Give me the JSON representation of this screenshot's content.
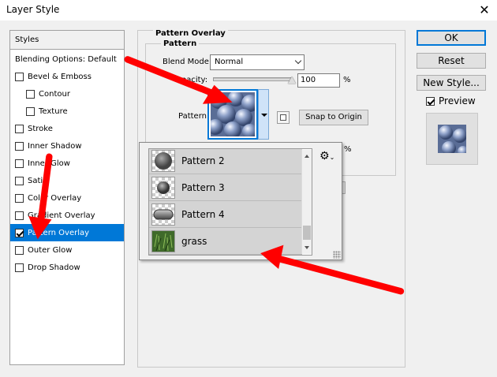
{
  "window": {
    "title": "Layer Style"
  },
  "sidebar": {
    "header": "Styles",
    "items": [
      {
        "label": "Blending Options: Default",
        "checkbox": false,
        "checked": false,
        "indent": 0
      },
      {
        "label": "Bevel & Emboss",
        "checkbox": true,
        "checked": false,
        "indent": 0
      },
      {
        "label": "Contour",
        "checkbox": true,
        "checked": false,
        "indent": 1
      },
      {
        "label": "Texture",
        "checkbox": true,
        "checked": false,
        "indent": 1
      },
      {
        "label": "Stroke",
        "checkbox": true,
        "checked": false,
        "indent": 0
      },
      {
        "label": "Inner Shadow",
        "checkbox": true,
        "checked": false,
        "indent": 0
      },
      {
        "label": "Inner Glow",
        "checkbox": true,
        "checked": false,
        "indent": 0
      },
      {
        "label": "Satin",
        "checkbox": true,
        "checked": false,
        "indent": 0
      },
      {
        "label": "Color Overlay",
        "checkbox": true,
        "checked": false,
        "indent": 0
      },
      {
        "label": "Gradient Overlay",
        "checkbox": true,
        "checked": false,
        "indent": 0
      },
      {
        "label": "Pattern Overlay",
        "checkbox": true,
        "checked": true,
        "indent": 0,
        "selected": true
      },
      {
        "label": "Outer Glow",
        "checkbox": true,
        "checked": false,
        "indent": 0
      },
      {
        "label": "Drop Shadow",
        "checkbox": true,
        "checked": false,
        "indent": 0
      }
    ]
  },
  "main": {
    "section_title": "Pattern Overlay",
    "group_title": "Pattern",
    "blend_mode_label": "Blend Mode:",
    "blend_mode_value": "Normal",
    "opacity_label": "Opacity:",
    "opacity_value": "100",
    "opacity_unit": "%",
    "opacity_level": 100,
    "pattern_label": "Pattern:",
    "snap_button": "Snap to Origin",
    "scale_unit": "%"
  },
  "pattern_picker": {
    "items": [
      {
        "name": "Pattern 2",
        "thumb": "sphere-pattern"
      },
      {
        "name": "Pattern 3",
        "thumb": "dot-pattern"
      },
      {
        "name": "Pattern 4",
        "thumb": "pill-pattern"
      },
      {
        "name": "grass",
        "thumb": "grass-pattern"
      }
    ],
    "gear_icon": "gear-icon"
  },
  "buttons": {
    "ok": "OK",
    "reset": "Reset",
    "new_style": "New Style...",
    "preview_label": "Preview",
    "preview_checked": true
  },
  "colors": {
    "selection": "#0078d7",
    "arrow": "#ff0000",
    "pattern_blue": "#6e84b0"
  }
}
